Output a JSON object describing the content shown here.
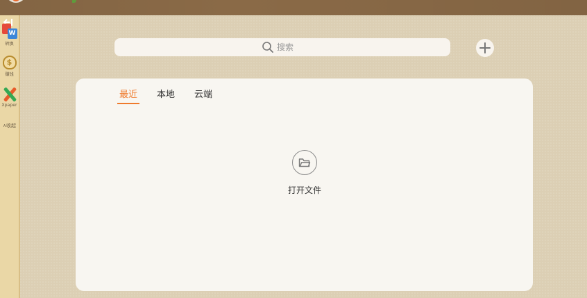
{
  "sidebar": {
    "items": [
      {
        "label": "转换",
        "icon": "pdf-word-convert-icon"
      },
      {
        "label": "赚钱",
        "icon": "money-bag-icon"
      },
      {
        "label": "Xpaper",
        "icon": "xpaper-icon"
      }
    ],
    "collect_label": "∧收起"
  },
  "search": {
    "placeholder": "搜索"
  },
  "tabs": [
    {
      "label": "最近",
      "active": true
    },
    {
      "label": "本地",
      "active": false
    },
    {
      "label": "云端",
      "active": false
    }
  ],
  "open_file": {
    "label": "打开文件"
  },
  "colors": {
    "accent": "#ef7a2c",
    "topbar": "#8a6a47",
    "sidebar": "#ead7a6",
    "background": "#dccfb4"
  }
}
